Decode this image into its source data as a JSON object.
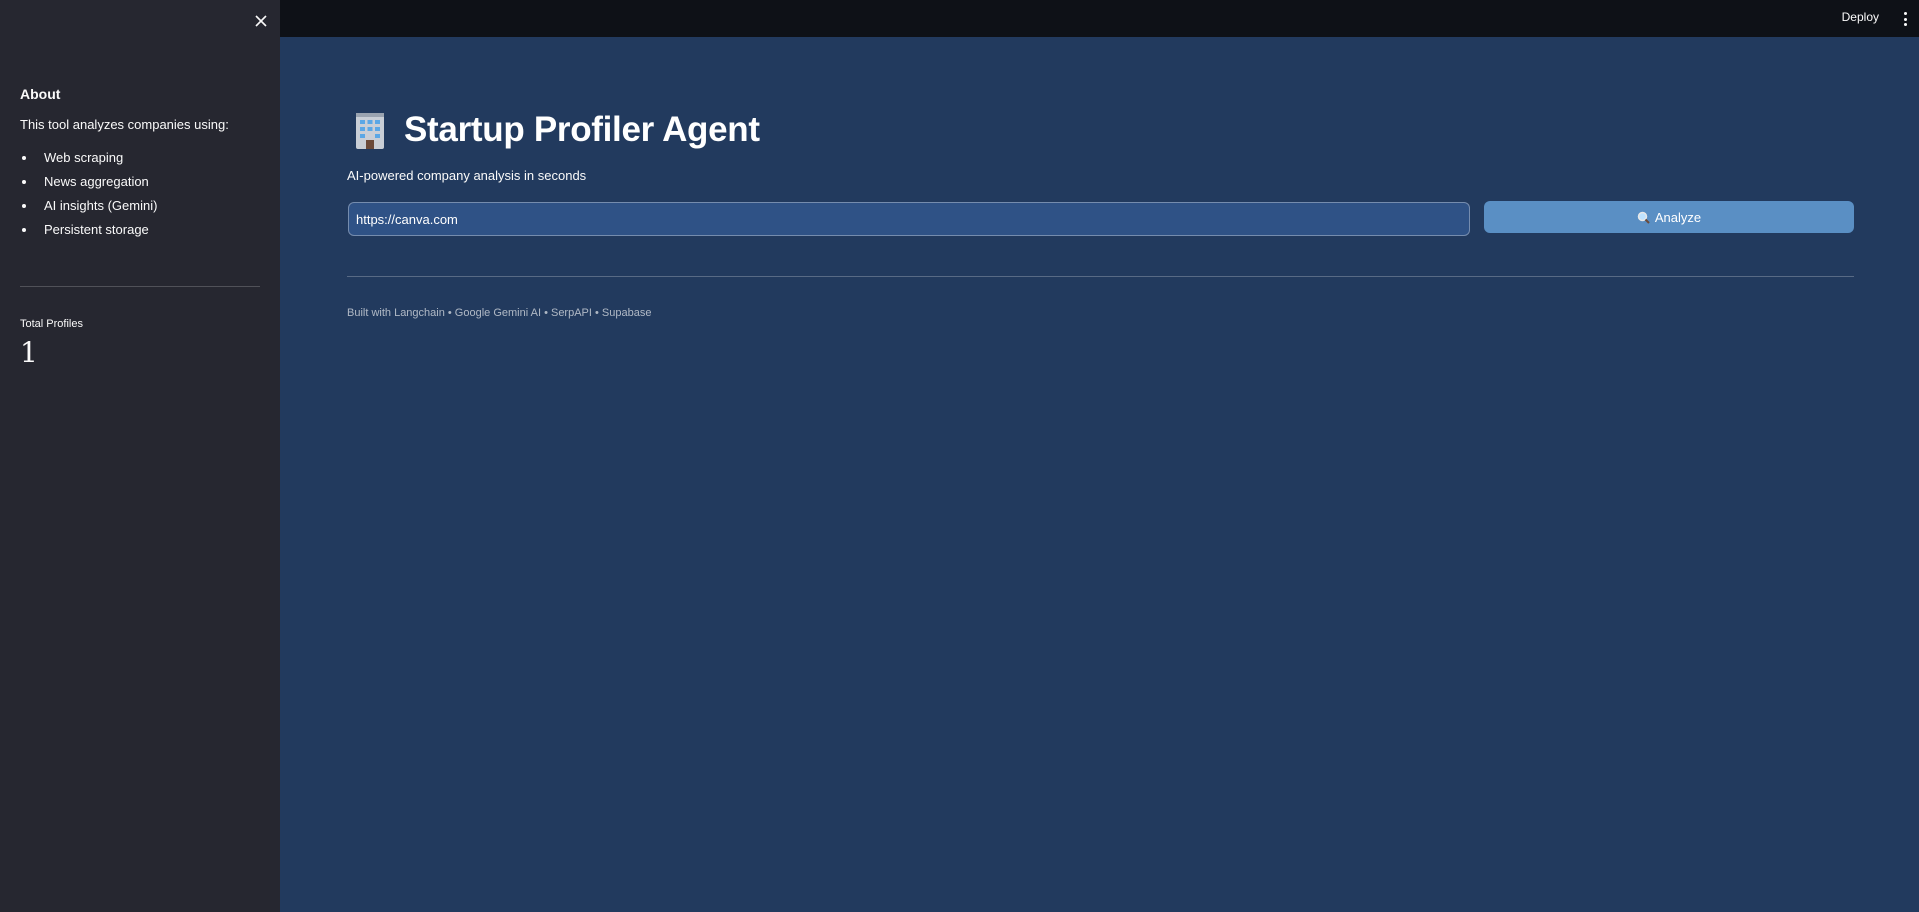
{
  "sidebar": {
    "close_icon": "close-icon",
    "about_heading": "About",
    "about_desc": "This tool analyzes companies using:",
    "features": [
      "Web scraping",
      "News aggregation",
      "AI insights (Gemini)",
      "Persistent storage"
    ],
    "metric_label": "Total Profiles",
    "metric_value": "1"
  },
  "header": {
    "deploy_label": "Deploy",
    "menu_icon": "more-vertical-icon"
  },
  "main": {
    "title_icon": "office-building-emoji",
    "title": "Startup Profiler Agent",
    "subtitle": "AI-powered company analysis in seconds",
    "url_input_value": "https://canva.com",
    "analyze_icon": "magnifying-glass-icon",
    "analyze_label": "Analyze",
    "footer": "Built with Langchain • Google Gemini AI • SerpAPI • Supabase"
  },
  "colors": {
    "sidebar_bg": "#262730",
    "main_bg": "#223a5e",
    "header_bg": "#0e1117",
    "input_bg": "#2f5286",
    "button_bg": "#5a8fc4"
  }
}
